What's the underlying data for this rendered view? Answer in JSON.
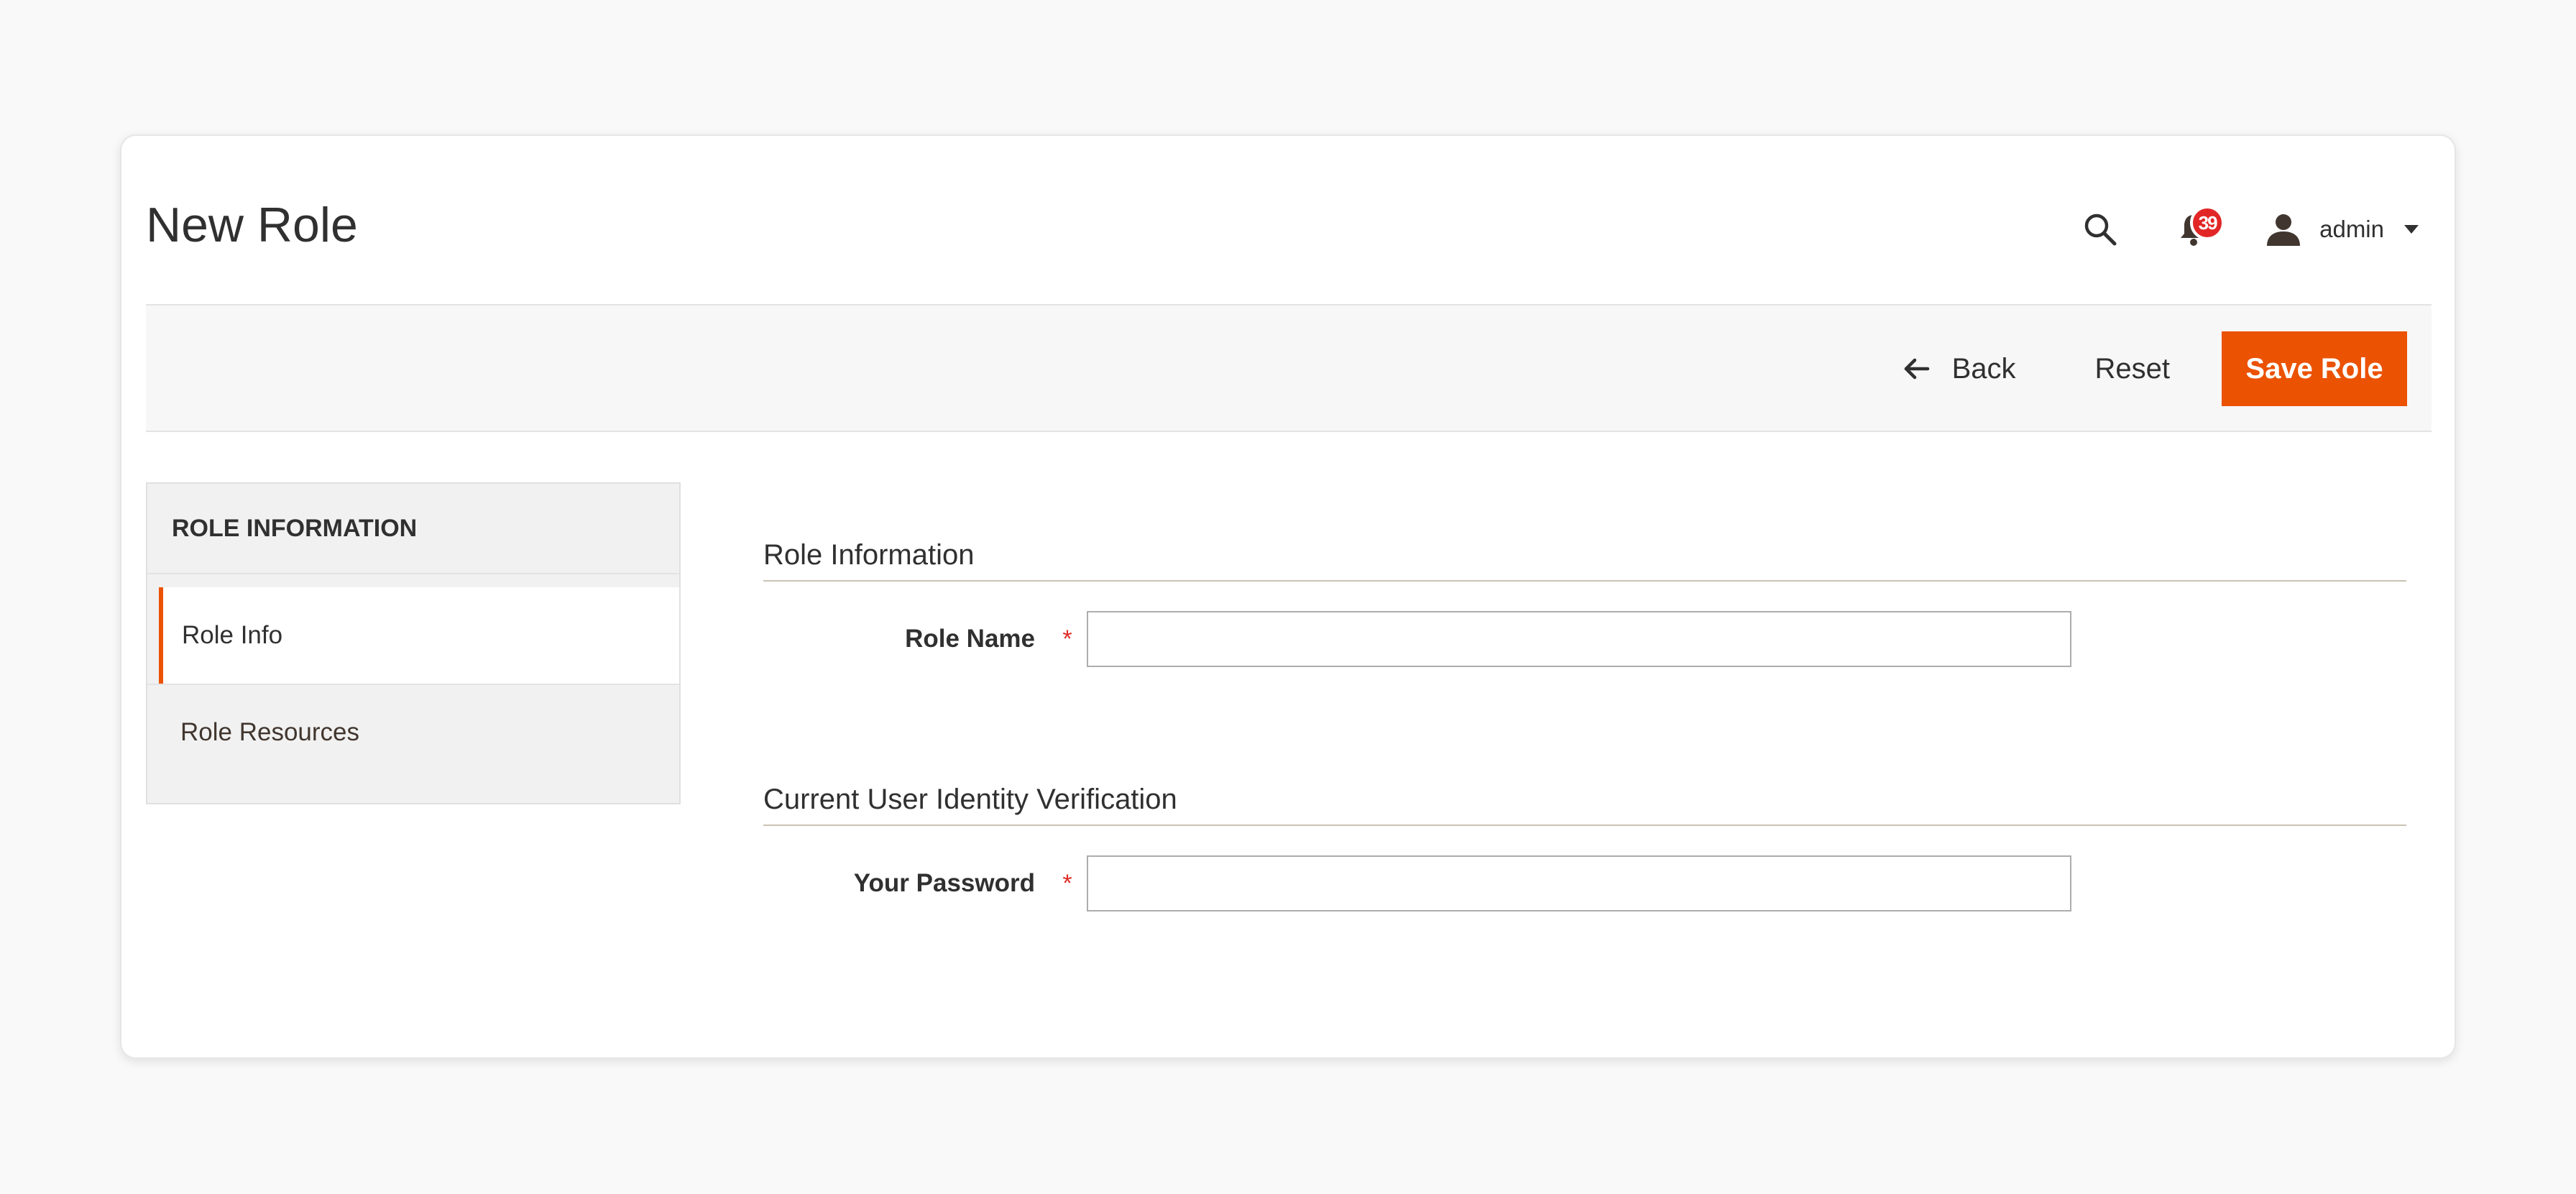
{
  "page": {
    "title": "New Role"
  },
  "header": {
    "search_icon": "search-icon",
    "notifications": {
      "icon": "bell-icon",
      "count": "39",
      "badge_color": "#e22626"
    },
    "user": {
      "icon": "user-icon",
      "name": "admin"
    }
  },
  "toolbar": {
    "back_label": "Back",
    "reset_label": "Reset",
    "save_label": "Save Role",
    "accent_color": "#eb5202"
  },
  "tabs": {
    "title": "ROLE INFORMATION",
    "items": [
      {
        "label": "Role Info",
        "active": true
      },
      {
        "label": "Role Resources",
        "active": false
      }
    ]
  },
  "sections": [
    {
      "title": "Role Information",
      "fields": [
        {
          "label": "Role Name",
          "required": "*",
          "value": "",
          "placeholder": ""
        }
      ]
    },
    {
      "title": "Current User Identity Verification",
      "fields": [
        {
          "label": "Your Password",
          "required": "*",
          "value": "",
          "placeholder": ""
        }
      ]
    }
  ]
}
